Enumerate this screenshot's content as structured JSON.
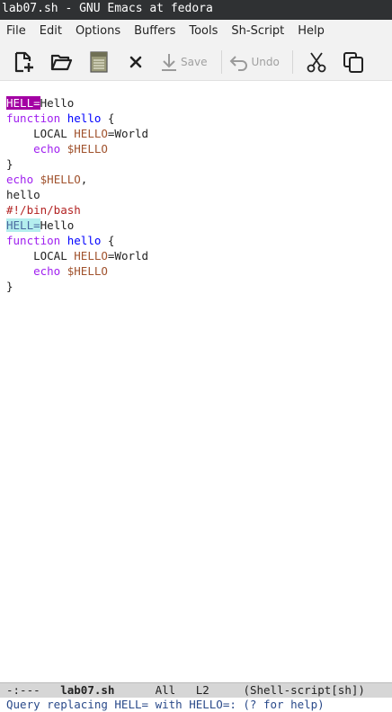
{
  "window": {
    "title": "lab07.sh - GNU Emacs at fedora"
  },
  "menu": [
    "File",
    "Edit",
    "Options",
    "Buffers",
    "Tools",
    "Sh-Script",
    "Help"
  ],
  "toolbar": {
    "new_icon": "new-file-icon",
    "open_icon": "open-folder-icon",
    "save_buffer_icon": "save-buffer-icon",
    "close_icon": "close-icon",
    "save_label": "Save",
    "undo_label": "Undo",
    "cut_icon": "cut-icon",
    "copy_icon": "copy-icon"
  },
  "buffer": {
    "lines": [
      {
        "match": "HELL=",
        "rest": "Hello"
      },
      {
        "kw": "function",
        "sp": " ",
        "fn": "hello",
        "rest": " {"
      },
      {
        "indent": "    LOCAL ",
        "var": "HELLO",
        "rest": "=World"
      },
      {
        "indent": "    ",
        "kw": "echo",
        "sp": " ",
        "var": "$HELLO"
      },
      {
        "rest": "}"
      },
      {
        "kw": "echo",
        "sp": " ",
        "var": "$HELLO",
        "rest": ","
      },
      {
        "rest": "hello"
      },
      {
        "cmt": "#!/bin/bash"
      },
      {
        "match2": "HELL=",
        "rest": "Hello"
      },
      {
        "kw": "function",
        "sp": " ",
        "fn": "hello",
        "rest": " {"
      },
      {
        "indent": "    LOCAL ",
        "var": "HELLO",
        "rest": "=World"
      },
      {
        "indent": "    ",
        "kw": "echo",
        "sp": " ",
        "var": "$HELLO"
      },
      {
        "rest": "}"
      }
    ]
  },
  "modeline": {
    "status": "-:---",
    "buffer_name": "lab07.sh",
    "position": "All",
    "line": "L2",
    "mode": "(Shell-script[sh])"
  },
  "minibuffer": {
    "prompt": "Query replacing HELL= with HELLO=: (? for help)"
  }
}
